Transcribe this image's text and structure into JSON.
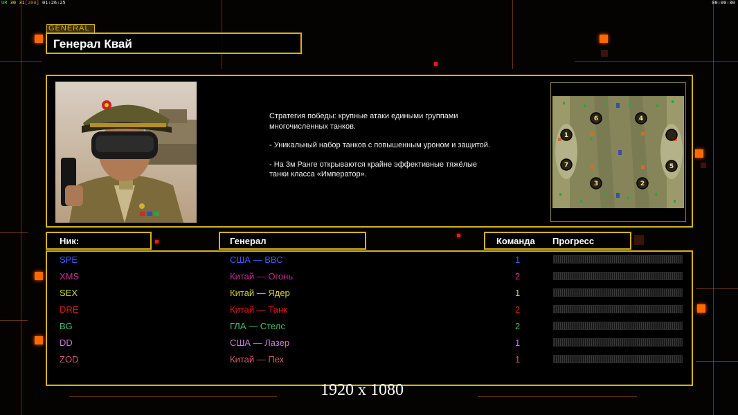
{
  "hud": {
    "left_label_1": "UR",
    "left_fps": "30",
    "left_fps2": "31",
    "left_limit": "[200]",
    "left_time": "01:26:25",
    "right_time": "00:00:00"
  },
  "general_tag": "GENERAL",
  "general_title": "Генерал Квай",
  "description": {
    "line1": "Стратегия победы: крупные атаки едиными группами многочисленных танков.",
    "line2": "- Уникальный набор танков с повышенным уроном и защитой.",
    "line3": "- На 3м Ранге открываются крайне эффективные тяжёлые танки класса «Император»."
  },
  "map_slots": [
    "1",
    "2",
    "3",
    "4",
    "5",
    "6",
    "7"
  ],
  "headers": {
    "nick": "Ник:",
    "general": "Генерал",
    "team": "Команда",
    "progress": "Прогресс"
  },
  "players": [
    {
      "nick": "SPE",
      "general": "США — ВВС",
      "team": "1",
      "color": "#3a5cff"
    },
    {
      "nick": "XMS",
      "general": "Китай — Огонь",
      "team": "2",
      "color": "#d02a9c"
    },
    {
      "nick": "SEX",
      "general": "Китай — Ядер",
      "team": "1",
      "color": "#d6d623"
    },
    {
      "nick": "DRE",
      "general": "Китай — Танк",
      "team": "2",
      "color": "#e01818"
    },
    {
      "nick": "BG",
      "general": "ГЛА — Стелс",
      "team": "2",
      "color": "#35c46a"
    },
    {
      "nick": "DD",
      "general": "США — Лазер",
      "team": "1",
      "color": "#c878e0"
    },
    {
      "nick": "ZOD",
      "general": "Китай — Пех",
      "team": "1",
      "color": "#d65a6a"
    }
  ],
  "progress_values": [
    0,
    0,
    0,
    0,
    0,
    0,
    0
  ],
  "resolution_label": "1920 x 1080"
}
